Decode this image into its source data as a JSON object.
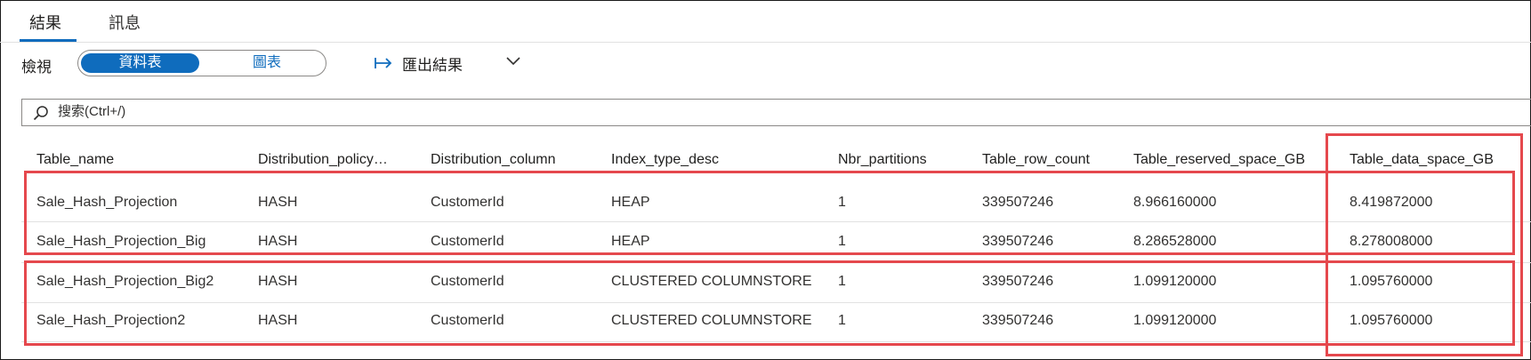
{
  "tabs": [
    {
      "label": "結果"
    },
    {
      "label": "訊息"
    }
  ],
  "toolbar": {
    "view_label": "檢視",
    "toggle_table": "資料表",
    "toggle_chart": "圖表",
    "export_label": "匯出結果"
  },
  "search": {
    "placeholder": "搜索(Ctrl+/)"
  },
  "table": {
    "columns": [
      "Table_name",
      "Distribution_policy…",
      "Distribution_column",
      "Index_type_desc",
      "Nbr_partitions",
      "Table_row_count",
      "Table_reserved_space_GB",
      "Table_data_space_GB"
    ],
    "rows": [
      [
        "Sale_Hash_Projection",
        "HASH",
        "CustomerId",
        "HEAP",
        "1",
        "339507246",
        "8.966160000",
        "8.419872000"
      ],
      [
        "Sale_Hash_Projection_Big",
        "HASH",
        "CustomerId",
        "HEAP",
        "1",
        "339507246",
        "8.286528000",
        "8.278008000"
      ],
      [
        "Sale_Hash_Projection_Big2",
        "HASH",
        "CustomerId",
        "CLUSTERED COLUMNSTORE",
        "1",
        "339507246",
        "1.099120000",
        "1.095760000"
      ],
      [
        "Sale_Hash_Projection2",
        "HASH",
        "CustomerId",
        "CLUSTERED COLUMNSTORE",
        "1",
        "339507246",
        "1.099120000",
        "1.095760000"
      ]
    ]
  },
  "colors": {
    "accent": "#0f6cbd",
    "highlight": "#e5484d"
  }
}
